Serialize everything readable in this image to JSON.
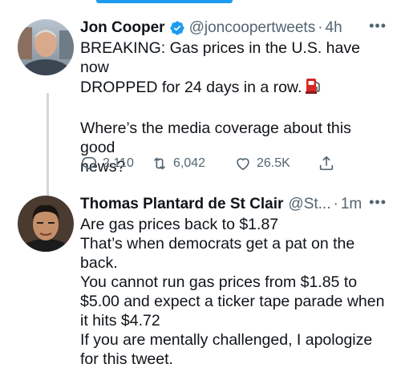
{
  "tweets": [
    {
      "author": "Jon Cooper",
      "handle": "@joncoopertweets",
      "separator": "·",
      "time": "4h",
      "more_label": "•••",
      "lines": [
        "BREAKING: Gas prices in the U.S. have now",
        "DROPPED for 24 days in a row.",
        "",
        "Where’s the media coverage about this good",
        "news?"
      ],
      "emoji": "fuel-pump-icon",
      "stats": {
        "replies": "2,110",
        "retweets": "6,042",
        "likes": "26.5K"
      },
      "verified": true
    },
    {
      "author": "Thomas Plantard de St Clair",
      "handle": "@St...",
      "separator": "·",
      "time": "1m",
      "more_label": "•••",
      "lines": [
        "Are gas prices back to $1.87",
        "That’s when democrats get a pat on the",
        "back.",
        "You cannot run gas prices from $1.85 to",
        "$5.00 and expect a ticker tape parade when",
        "it hits $4.72",
        "If you are mentally challenged, I apologize",
        "for this tweet."
      ],
      "verified": false
    }
  ],
  "colors": {
    "accent": "#1d9bf0",
    "secondary_text": "#536471",
    "thread_line": "#cfd9de"
  }
}
